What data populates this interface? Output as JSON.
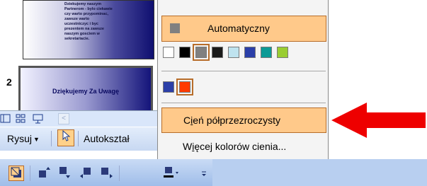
{
  "slides": {
    "slide1_text": "Dziekujemy naszym\nPartnerom - bylo ciekawie\nczy warto przypominac,\nzawsze warto\nuczestniczyc i byc\nprezentem na zawsze\nnaszym gosciem w\nsekretariacie.",
    "slide2_number": "2",
    "slide2_title": "Dziękujemy Za Uwagę"
  },
  "view_bar": {
    "scroll_left_glyph": "<"
  },
  "draw_toolbar": {
    "rysuj_label": "Rysuj",
    "dropdown_caret": "▼",
    "autoksztalty_label": "Autokształ"
  },
  "shadow_menu": {
    "automatic_label": "Automatyczny",
    "swatches": [
      {
        "color": "#ffffff",
        "name": "white"
      },
      {
        "color": "#000000",
        "name": "black"
      },
      {
        "color": "#808080",
        "name": "gray",
        "selected": true
      },
      {
        "color": "#1a1a1a",
        "name": "black2"
      },
      {
        "color": "#bfe3ef",
        "name": "light-cyan"
      },
      {
        "color": "#2b3fa8",
        "name": "blue"
      },
      {
        "color": "#0c9a96",
        "name": "teal"
      },
      {
        "color": "#9acd32",
        "name": "lime"
      }
    ],
    "recent_swatches": [
      {
        "color": "#2b3fa8",
        "name": "blue"
      },
      {
        "color": "#ff3a00",
        "name": "orange-red",
        "selected": true
      }
    ],
    "semi_transparent_prefix": "C",
    "semi_transparent_underlined": "i",
    "semi_transparent_rest": "eń półprzezroczysty",
    "more_colors_prefix": "W",
    "more_colors_underlined": "i",
    "more_colors_rest": "ęcej kolorów cienia..."
  },
  "colors": {
    "highlight": "#ffc98a",
    "highlight_border": "#b76d2a",
    "arrow": "#ee0000",
    "toolbar": "#c9dbf5"
  }
}
